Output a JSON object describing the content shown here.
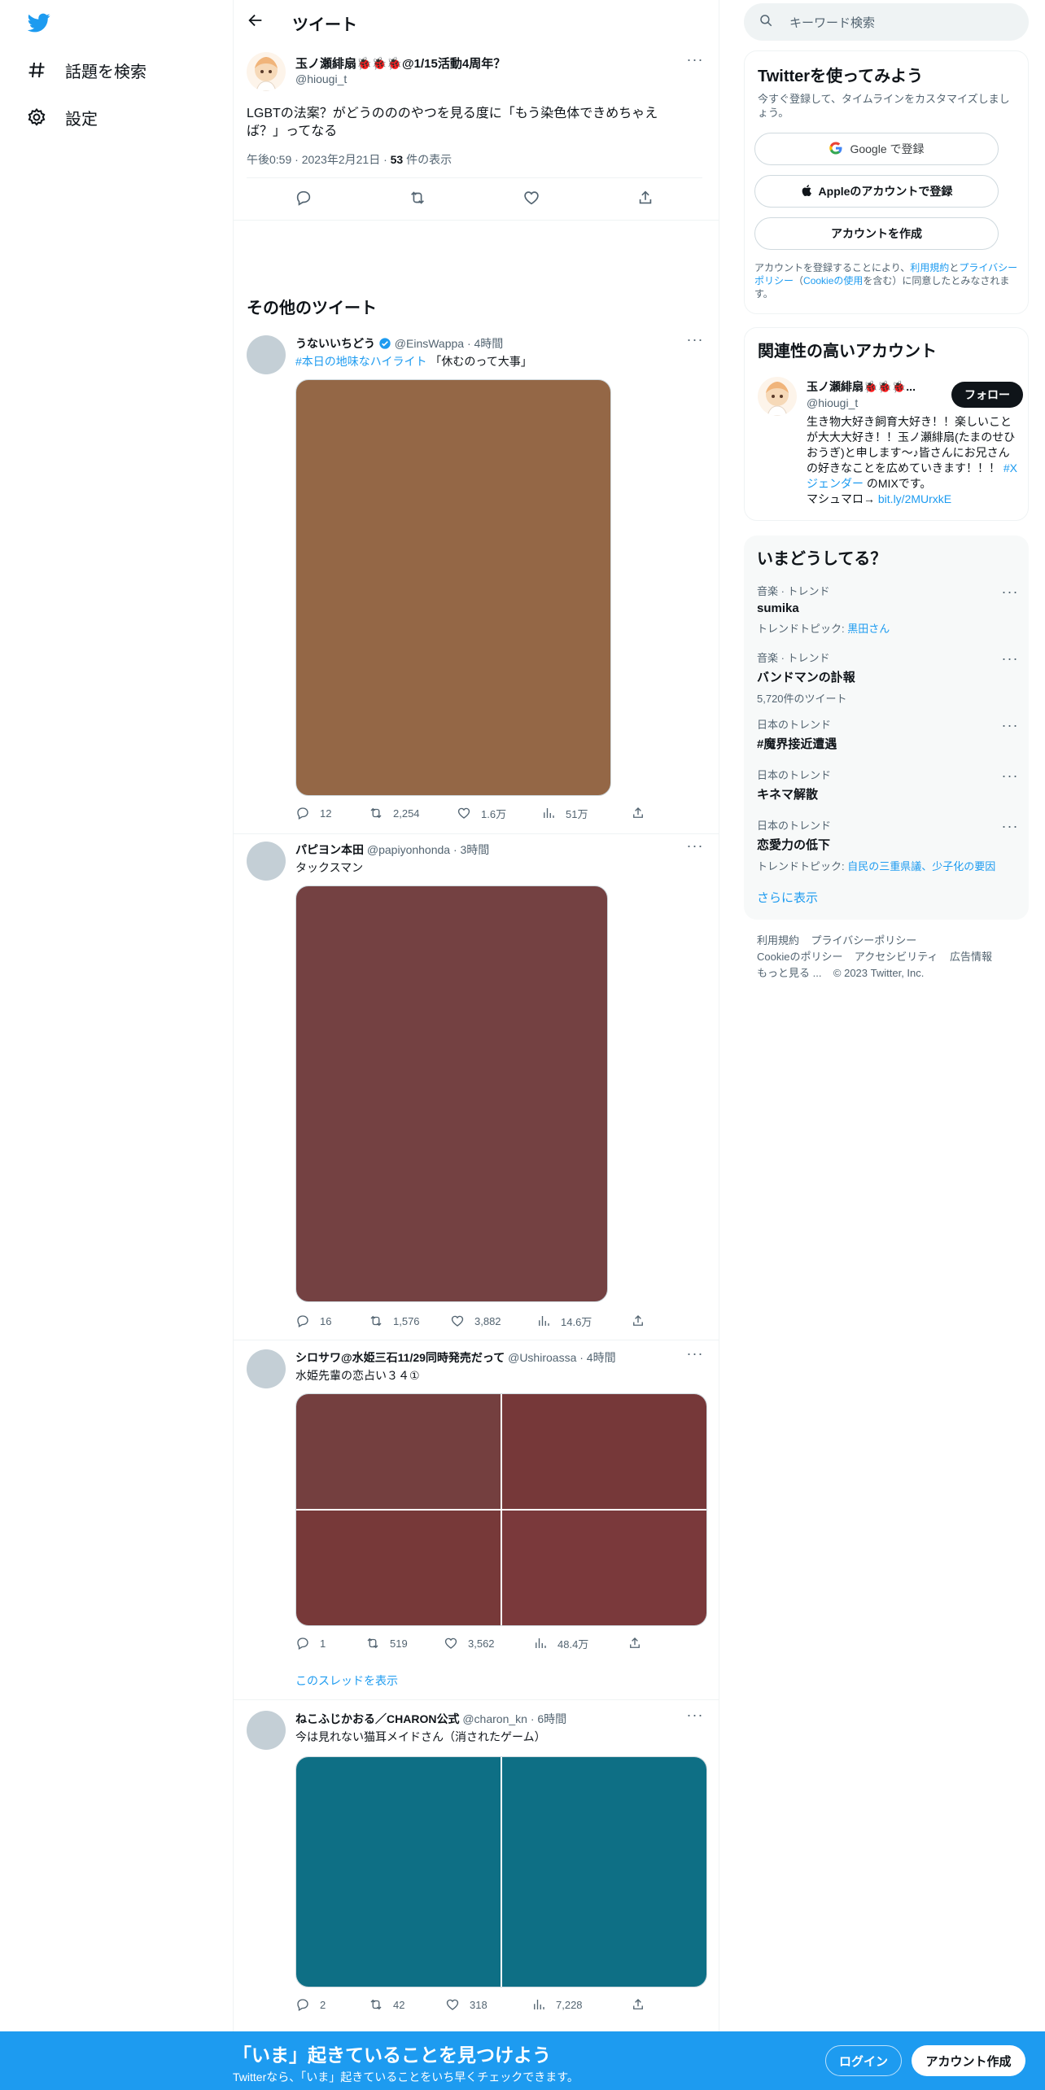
{
  "nav": {
    "explore_label": "話題を検索",
    "settings_label": "設定"
  },
  "header": {
    "title": "ツイート"
  },
  "main_tweet": {
    "name": "玉ノ瀬緋扇🐞🐞🐞@1/15活動4周年？",
    "handle": "@hiougi_t",
    "text_line1": "LGBTの法案？がどうのののやつを見る度に「もう染色体できめちゃえ",
    "text_line2": "ば？」ってなる",
    "timestamp": "午後0:59 · 2023年2月21日 · ",
    "views_count": "53",
    "views_label": " 件の表示"
  },
  "more_tweets_title": "その他のツイート",
  "tweets": [
    {
      "name": "うないいちどう",
      "handle": "@EinsWappa",
      "time": "· 4時間",
      "hashtag": "#本日の地味なハイライト",
      "text": " 「休むのって大事」",
      "media_color": "#946746",
      "replies": "12",
      "retweets": "2,254",
      "likes": "1.6万",
      "views": "51万"
    },
    {
      "name": "パピヨン本田",
      "handle": "@papiyonhonda",
      "time": "· 3時間",
      "text": "タックスマン",
      "media_color": "#744142",
      "replies": "16",
      "retweets": "1,576",
      "likes": "3,882",
      "views": "14.6万"
    },
    {
      "name": "シロサワ@水姫三石11/29同時発売だって",
      "handle": "@Ushiroassa",
      "time": "· 4時間",
      "text": "水姫先輩の恋占い３４①",
      "media_colors": [
        "#743f3f",
        "#763839",
        "#773939",
        "#7a393b"
      ],
      "replies": "1",
      "retweets": "519",
      "likes": "3,562",
      "views": "48.4万",
      "thread_link": "このスレッドを表示"
    },
    {
      "name": "ねこふじかおる／CHARON公式",
      "handle": "@charon_kn",
      "time": "· 6時間",
      "text": "今は見れない猫耳メイドさん（消されたゲーム）",
      "media_colors": [
        "#0e6f85",
        "#0e6f85"
      ],
      "replies": "2",
      "retweets": "42",
      "likes": "318",
      "views": "7,228"
    }
  ],
  "search": {
    "placeholder": "キーワード検索"
  },
  "signup_card": {
    "title": "Twitterを使ってみよう",
    "subtitle": "今すぐ登録して、タイムラインをカスタマイズしましょう。",
    "google_label": "Google で登録",
    "apple_label": "Appleのアカウントで登録",
    "create_label": "アカウントを作成",
    "legal_1": "アカウントを登録することにより、",
    "legal_terms": "利用規約",
    "legal_2": "と",
    "legal_privacy": "プライバシーポリシー",
    "legal_3": "（",
    "legal_cookie": "Cookieの使用",
    "legal_4": "を含む）に同意したとみなされます。"
  },
  "related_card": {
    "title": "関連性の高いアカウント",
    "name": "玉ノ瀬緋扇🐞🐞🐞...",
    "handle": "@hiougi_t",
    "follow_label": "フォロー",
    "bio_1": "生き物大好き飼育大好き！！楽しいことが大大大好き！！玉ノ瀬緋扇(たまのせひおうぎ)と申します〜♪皆さんにお兄さんの好きなことを広めていきます！！！ ",
    "bio_tag": "#Xジェンダー",
    "bio_2": " のMIXです。",
    "bio_3": "マシュマロ→ ",
    "bio_link": "bit.ly/2MUrxkE"
  },
  "trends_card": {
    "title": "いまどうしてる？",
    "items": [
      {
        "meta": "音楽 · トレンド",
        "name": "sumika",
        "extra_label": "トレンドトピック: ",
        "extra_link": "黒田さん"
      },
      {
        "meta": "音楽 · トレンド",
        "name": "バンドマンの訃報",
        "extra": "5,720件のツイート"
      },
      {
        "meta": "日本のトレンド",
        "name": "#魔界接近遭遇"
      },
      {
        "meta": "日本のトレンド",
        "name": "キネマ解散"
      },
      {
        "meta": "日本のトレンド",
        "name": "恋愛力の低下",
        "extra_label": "トレンドトピック: ",
        "extra_link": "自民の三重県議、少子化の要因"
      }
    ],
    "show_more": "さらに表示"
  },
  "footer": {
    "terms": "利用規約",
    "privacy": "プライバシーポリシー",
    "cookie": "Cookieのポリシー",
    "accessibility": "アクセシビリティ",
    "ads": "広告情報",
    "more": "もっと見る ...",
    "copyright": "© 2023 Twitter, Inc."
  },
  "banner": {
    "title": "「いま」起きていることを見つけよう",
    "subtitle": "Twitterなら、「いま」起きていることをいち早くチェックできます。",
    "login_label": "ログイン",
    "signup_label": "アカウント作成"
  },
  "colors": {
    "accent": "#1d9bf0",
    "verified": "#1d9bf0"
  }
}
